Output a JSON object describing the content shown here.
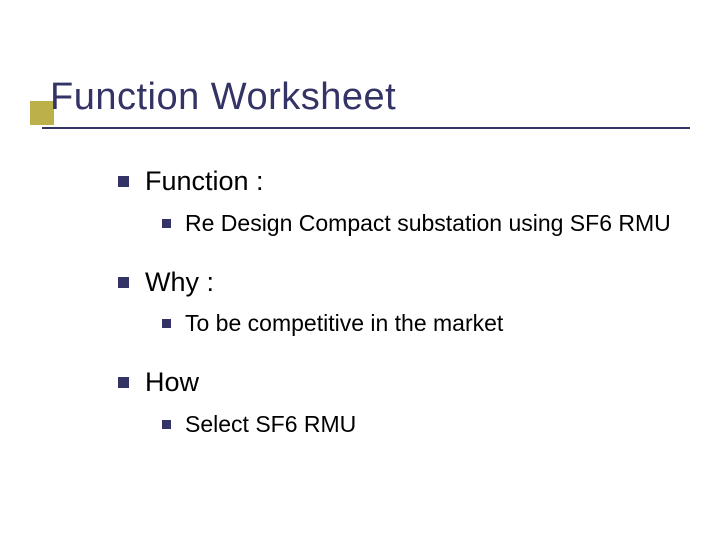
{
  "title": "Function Worksheet",
  "sections": [
    {
      "heading": "Function :",
      "items": [
        "Re Design Compact substation using SF6 RMU"
      ]
    },
    {
      "heading": "Why :",
      "items": [
        "To be competitive in the market"
      ]
    },
    {
      "heading": "How",
      "items": [
        "Select SF6 RMU"
      ]
    }
  ],
  "colors": {
    "accent_square": "#bcb04a",
    "heading_and_bullets": "#333366"
  }
}
